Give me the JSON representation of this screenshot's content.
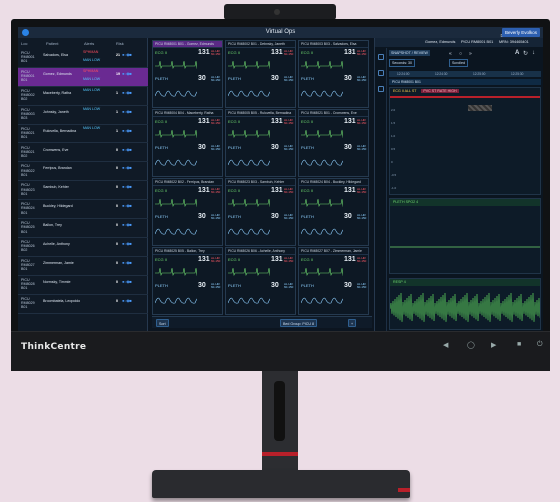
{
  "monitor": {
    "brand": "ThinkCentre"
  },
  "app": {
    "title": "Virtual Ops",
    "dark_mode_label": "Dark",
    "user_button": "Beverly Evolkos"
  },
  "patient_list": {
    "headers": [
      "Loc",
      "Patient",
      "Alerts",
      "Risk"
    ],
    "rows": [
      {
        "loc": "PICU RM8001 B01",
        "patient": "Salvadors, Elsa",
        "alert": "SPHMAN",
        "alert2": "MAN LOW",
        "risk": "21",
        "selected": false,
        "alert_red": true
      },
      {
        "loc": "PICU RM8001 B01",
        "patient": "Gomez, Edmunds",
        "alert": "SPHMAN",
        "alert2": "MAN LOW",
        "risk": "19",
        "selected": true,
        "alert_red": true
      },
      {
        "loc": "PICU RM8002 B02",
        "patient": "Maceberty, Ratha",
        "alert": "MAN LOW",
        "alert2": "",
        "risk": "1",
        "selected": false,
        "alert_red": false
      },
      {
        "loc": "PICU RM8003 B03",
        "patient": "Johnsky, Janeth",
        "alert": "MAN LOW",
        "alert2": "",
        "risk": "1",
        "selected": false,
        "alert_red": false
      },
      {
        "loc": "PICU RM8021 B01",
        "patient": "Rulovella, Bernadina",
        "alert": "MAN LOW",
        "alert2": "",
        "risk": "1",
        "selected": false,
        "alert_red": false
      },
      {
        "loc": "PICU RM8021 B02",
        "patient": "Cromwens, Eve",
        "alert": "",
        "alert2": "",
        "risk": "0",
        "selected": false,
        "alert_red": false
      },
      {
        "loc": "PICU RM8022 B01",
        "patient": "Ferripus, Brandan",
        "alert": "",
        "alert2": "",
        "risk": "0",
        "selected": false,
        "alert_red": false
      },
      {
        "loc": "PICU RM8023 B01",
        "patient": "Sambuh, Kehler",
        "alert": "",
        "alert2": "",
        "risk": "0",
        "selected": false,
        "alert_red": false
      },
      {
        "loc": "PICU RM8024 B01",
        "patient": "Buckley, Hildegard",
        "alert": "",
        "alert2": "",
        "risk": "0",
        "selected": false,
        "alert_red": false
      },
      {
        "loc": "PICU RM8025 B01",
        "patient": "Ballon, Trey",
        "alert": "",
        "alert2": "",
        "risk": "0",
        "selected": false,
        "alert_red": false
      },
      {
        "loc": "PICU RM8026 B02",
        "patient": "Achelle, Anthony",
        "alert": "",
        "alert2": "",
        "risk": "0",
        "selected": false,
        "alert_red": false
      },
      {
        "loc": "PICU RM8027 B01",
        "patient": "Zimmerman, Jamie",
        "alert": "",
        "alert2": "",
        "risk": "0",
        "selected": false,
        "alert_red": false
      },
      {
        "loc": "PICU RM8028 B01",
        "patient": "Normsky, Timmie",
        "alert": "",
        "alert2": "",
        "risk": "0",
        "selected": false,
        "alert_red": false
      },
      {
        "loc": "PICU RM8029 B01",
        "patient": "Broombatela, Leopoldo",
        "alert": "",
        "alert2": "",
        "risk": "0",
        "selected": false,
        "alert_red": false
      }
    ]
  },
  "tiles": [
    {
      "title": "PICU RM8001 B01 - Gomez, Edmunds",
      "hr": "131",
      "spo2": "30",
      "selected": true
    },
    {
      "title": "PICU RM8002 B01 - Debnsky, Janeth",
      "hr": "131",
      "spo2": "30",
      "selected": false
    },
    {
      "title": "PICU RM8003 B03 - Salvadors, Elsa",
      "hr": "131",
      "spo2": "30",
      "selected": false
    },
    {
      "title": "PICU RM8004 B04 - Maceberty, Ratha",
      "hr": "131",
      "spo2": "30",
      "selected": false
    },
    {
      "title": "PICU RM8005 B05 - Rulovella, Bernadina",
      "hr": "131",
      "spo2": "30",
      "selected": false
    },
    {
      "title": "PICU RM8021 B01 - Cromwens, Eve",
      "hr": "131",
      "spo2": "30",
      "selected": false
    },
    {
      "title": "PICU RM8022 B02 - Ferripus, Brandan",
      "hr": "131",
      "spo2": "30",
      "selected": false
    },
    {
      "title": "PICU RM8023 B03 - Sambuh, Kehler",
      "hr": "131",
      "spo2": "30",
      "selected": false
    },
    {
      "title": "PICU RM8024 B04 - Buckley, Hildegard",
      "hr": "131",
      "spo2": "30",
      "selected": false
    },
    {
      "title": "PICU RM8025 B05 - Ballon, Trey",
      "hr": "131",
      "spo2": "30",
      "selected": false
    },
    {
      "title": "PICU RM8026 B06 - Achelle, Anthony",
      "hr": "131",
      "spo2": "30",
      "selected": false
    },
    {
      "title": "PICU RM8027 B07 - Zimmerman, Jamie",
      "hr": "131",
      "spo2": "30",
      "selected": false
    }
  ],
  "tile_labels": {
    "ecg": "ECG II",
    "pleth": "PLETH",
    "alarm_note": "AL HR 60-150"
  },
  "mid_bar": {
    "sort": "Sort",
    "group": "Bed Group: PICU 8",
    "add": "+"
  },
  "detail": {
    "patient": "Gomez, Edmunds",
    "location": "PICU RM8001 B01",
    "mrn": "MRN: 394465401",
    "toolbar": {
      "snapshot": "SNAPSHOT / REVIEW",
      "duration": "Seconds: 30",
      "scroll": "Scrolled"
    },
    "timeline": [
      "12:24:00",
      "12:24:30",
      "12:25:00",
      "12:25:30"
    ],
    "panel1_label": "ECG II   ALL ST",
    "panel1_alert": "PVC ST RATE HIGH",
    "panel2_label": "PLETH   SPO2 4",
    "panel3_label": "RESP 4",
    "ylabels": [
      "2.0",
      "1.5",
      "1.0",
      "0.5",
      "0",
      "-0.5",
      "-1.0"
    ]
  },
  "colors": {
    "accent": "#2d5fb0",
    "selection": "#6a2a92",
    "ecg": "#6fd86f",
    "alarm": "#ff4d5e"
  }
}
